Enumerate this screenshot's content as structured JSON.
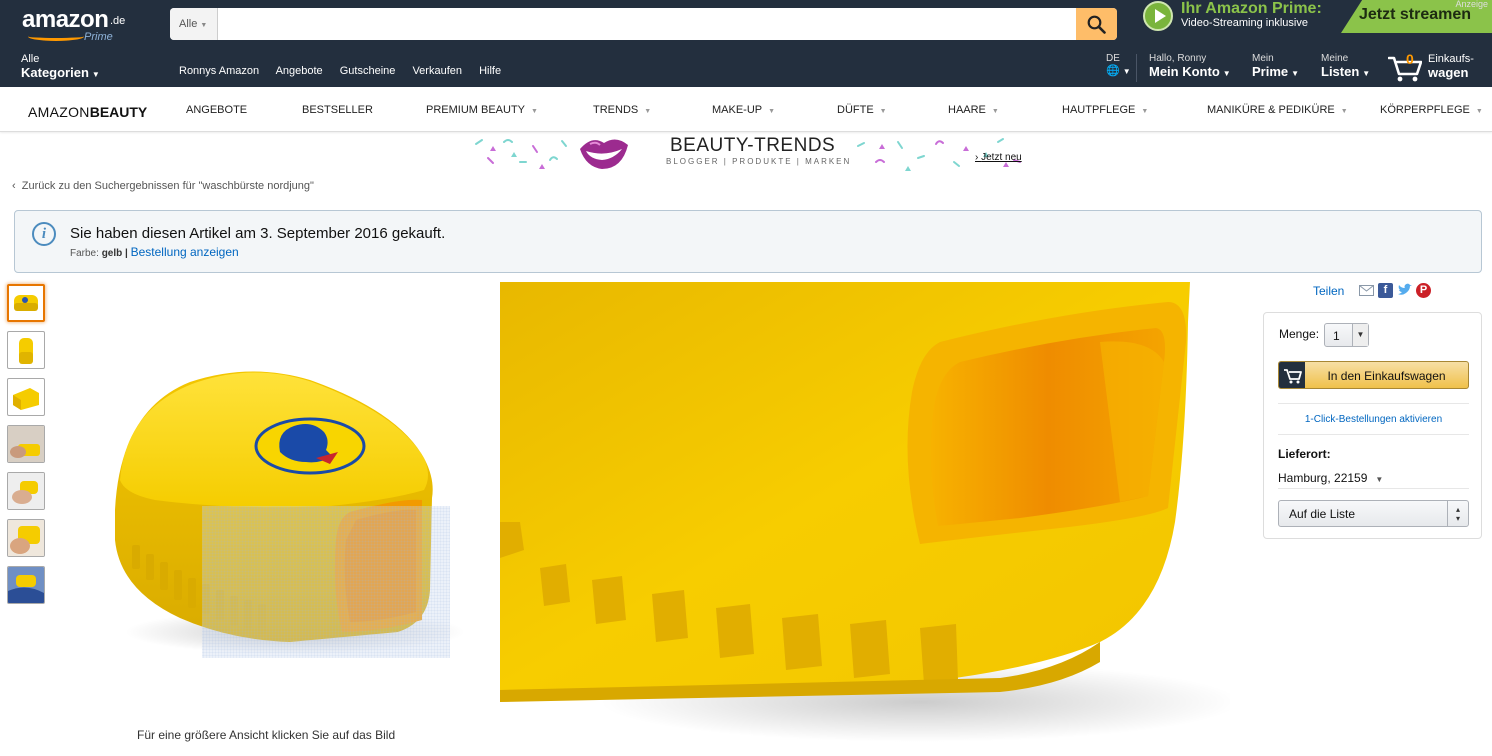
{
  "header": {
    "logo_text": "amazon",
    "logo_tld": ".de",
    "logo_sub": "Prime",
    "search": {
      "department": "Alle",
      "placeholder": "",
      "value": ""
    },
    "prime_ad": {
      "title": "Ihr Amazon Prime:",
      "subtitle": "Video-Streaming inklusive",
      "cta": "Jetzt streamen",
      "label": "Anzeige"
    }
  },
  "nav": {
    "categories_line1": "Alle",
    "categories_line2": "Kategorien",
    "links": [
      "Ronnys Amazon",
      "Angebote",
      "Gutscheine",
      "Verkaufen",
      "Hilfe"
    ],
    "language": "DE",
    "account_line1": "Hallo, Ronny",
    "account_line2": "Mein Konto",
    "prime_line1": "Mein",
    "prime_line2": "Prime",
    "lists_line1": "Meine",
    "lists_line2": "Listen",
    "cart_count": "0",
    "cart_line1": "Einkaufs-",
    "cart_line2": "wagen"
  },
  "subnav": {
    "brand_a": "AMAZON",
    "brand_b": "BEAUTY",
    "items": [
      "ANGEBOTE",
      "BESTSELLER",
      "PREMIUM BEAUTY",
      "TRENDS",
      "MAKE-UP",
      "DÜFTE",
      "HAARE",
      "HAUTPFLEGE",
      "MANIKÜRE & PEDIKÜRE",
      "KÖRPERPFLEGE"
    ]
  },
  "banner": {
    "title": "BEAUTY-TRENDS",
    "subtitle": "BLOGGER | PRODUKTE | MARKEN",
    "link": "Jetzt neu"
  },
  "breadcrumb": "Zurück zu den Suchergebnissen für \"waschbürste nordjung\"",
  "purchase_info": {
    "message": "Sie haben diesen Artikel am 3. September 2016 gekauft.",
    "color_label": "Farbe:",
    "color_value": "gelb",
    "order_link": "Bestellung anzeigen"
  },
  "gallery": {
    "thumbnail_count": 7,
    "active_thumbnail": 1,
    "caption": "Für eine größere Ansicht klicken Sie auf das Bild"
  },
  "share": {
    "label": "Teilen",
    "icons": [
      "mail-icon",
      "facebook-icon",
      "twitter-icon",
      "pinterest-icon"
    ]
  },
  "buybox": {
    "quantity_label": "Menge:",
    "quantity_value": "1",
    "add_to_cart": "In den Einkaufswagen",
    "one_click": "1-Click-Bestellungen aktivieren",
    "delivery_label": "Lieferort:",
    "delivery_value": "Hamburg, 22159",
    "wishlist": "Auf die Liste"
  },
  "colors": {
    "header_bg": "#232f3e",
    "search_button": "#febd69",
    "cart_button": "#f0c14b",
    "accent_orange": "#ff9900",
    "link_blue": "#0066c0",
    "product_yellow": "#f8d000",
    "prime_green": "#8bc34a"
  }
}
